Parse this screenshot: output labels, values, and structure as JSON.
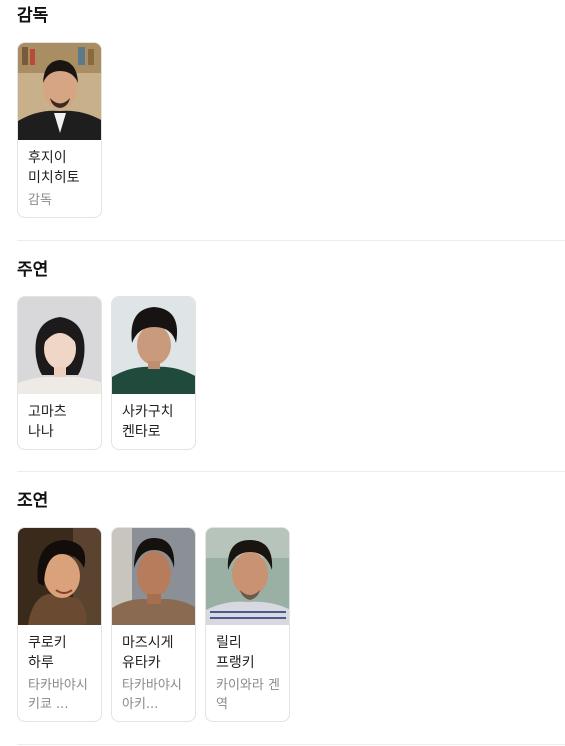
{
  "sections": {
    "director": {
      "title": "감독",
      "people": [
        {
          "name": "후지이 미치히토",
          "role": "감독"
        }
      ]
    },
    "lead": {
      "title": "주연",
      "people": [
        {
          "name": "고마츠 나나",
          "role": ""
        },
        {
          "name": "사카구치 켄타로",
          "role": ""
        }
      ]
    },
    "supporting": {
      "title": "조연",
      "people": [
        {
          "name": "쿠로키 하루",
          "role": "타카바야시 키쿄 ..."
        },
        {
          "name": "마즈시게 유타카",
          "role": "타카바야시 아키..."
        },
        {
          "name": "릴리 프랭키",
          "role": "카이와라 겐 역"
        }
      ]
    }
  },
  "icons": [
    "person-photo-placeholder"
  ],
  "colors": {
    "card_border": "#e3e3e3",
    "role_text": "#8a8a8a",
    "divider": "#ececec"
  }
}
